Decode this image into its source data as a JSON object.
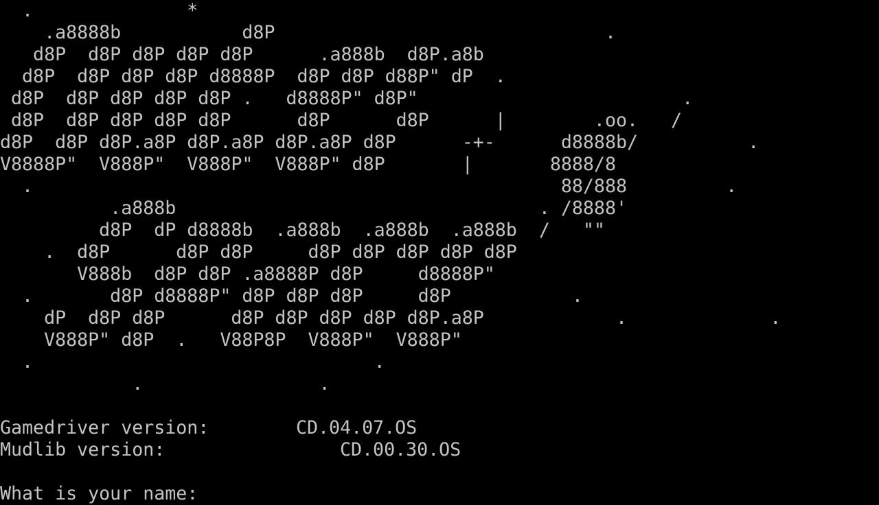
{
  "terminal": {
    "banner_lines": [
      "  .              *",
      "    .a8888b           d8P                              .",
      "   d8P  d8P d8P d8P d8P      .a888b  d8P.a8b",
      "  d8P  d8P d8P d8P d8888P  d8P d8P d88P\" dP  .",
      " d8P  d8P d8P d8P d8P .   d8888P\" d8P\"                        .",
      " d8P  d8P d8P d8P d8P      d8P      d8P      |        .oo.   /",
      "d8P  d8P d8P.a8P d8P.a8P d8P.a8P d8P      -+-      d8888b/          .",
      "V8888P\"  V888P\"  V888P\"  V888P\" d8P       |       8888/8",
      "  .                                                88/888         .",
      "          .a888b                                 . /8888'",
      "         d8P  dP d8888b  .a888b  .a888b  .a888b  /   \"\"",
      "    .  d8P      d8P d8P     d8P d8P d8P d8P d8P",
      "       V888b  d8P d8P .a8888P d8P     d8888P\"",
      "  .       d8P d8888P\" d8P d8P d8P     d8P           .",
      "    dP  d8P d8P      d8P d8P d8P d8P d8P.a8P            .             .",
      "    V888P\" d8P  .   V88P8P  V888P\"  V888P\"",
      "  .                               .",
      "            .                .",
      ""
    ],
    "gamedriver_label": "Gamedriver version:",
    "gamedriver_value": "CD.04.07.OS",
    "mudlib_label": "Mudlib version:",
    "mudlib_value": "CD.00.30.OS",
    "prompt_text": "What is your name: ",
    "input_value": ""
  },
  "colors": {
    "background": "#000000",
    "text": "#c4c4c4"
  }
}
